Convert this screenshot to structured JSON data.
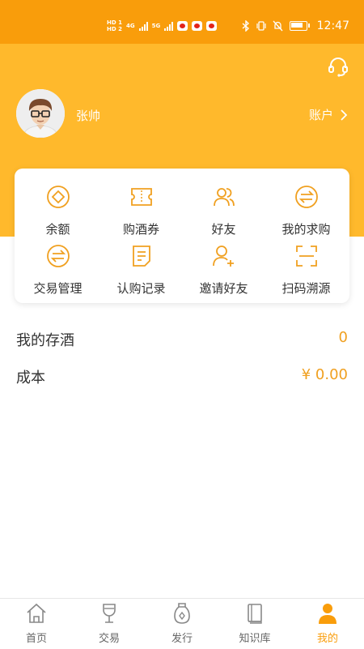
{
  "status_bar": {
    "hd1": "HD 1",
    "hd2": "HD 2",
    "net1": "4G",
    "net2": "5G",
    "time": "12:47"
  },
  "profile": {
    "username": "张帅",
    "account_label": "账户"
  },
  "grid": [
    {
      "label": "余额",
      "icon": "diamond-coin-icon"
    },
    {
      "label": "购酒券",
      "icon": "ticket-icon"
    },
    {
      "label": "好友",
      "icon": "friends-icon"
    },
    {
      "label": "我的求购",
      "icon": "exchange-arrows-icon"
    },
    {
      "label": "交易管理",
      "icon": "exchange-arrows-icon"
    },
    {
      "label": "认购记录",
      "icon": "document-list-icon"
    },
    {
      "label": "邀请好友",
      "icon": "add-user-icon"
    },
    {
      "label": "扫码溯源",
      "icon": "scan-icon"
    }
  ],
  "stats": {
    "stored_label": "我的存酒",
    "stored_value": "0",
    "cost_label": "成本",
    "cost_value": "¥ 0.00"
  },
  "tabs": [
    {
      "label": "首页",
      "icon": "home-icon"
    },
    {
      "label": "交易",
      "icon": "wine-glass-icon"
    },
    {
      "label": "发行",
      "icon": "bottle-icon"
    },
    {
      "label": "知识库",
      "icon": "book-icon"
    },
    {
      "label": "我的",
      "icon": "user-icon",
      "active": true
    }
  ],
  "colors": {
    "status_bar": "#f99d0b",
    "header": "#ffb92c",
    "accent": "#f0a020",
    "text": "#333333"
  }
}
